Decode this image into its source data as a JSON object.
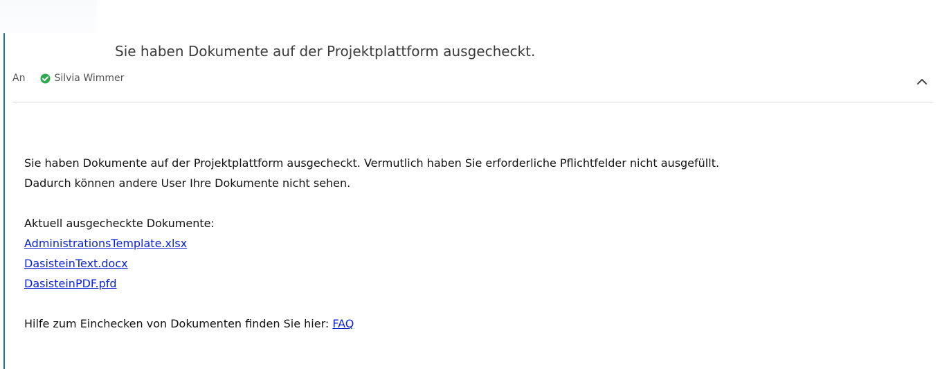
{
  "email": {
    "subject": "Sie haben Dokumente auf der Projektplattform ausgecheckt.",
    "to_label": "An",
    "recipient": "Silvia Wimmer",
    "recipient_status_color": "#2fa84f",
    "collapse_icon": "chevron-up-icon"
  },
  "body": {
    "intro_line1": "Sie haben Dokumente auf der Projektplattform ausgecheckt. Vermutlich haben Sie erforderliche Pflichtfelder nicht ausgefüllt.",
    "intro_line2": "Dadurch können andere User Ihre Dokumente nicht sehen.",
    "list_heading": "Aktuell ausgecheckte Dokumente:",
    "documents": [
      "AdministrationsTemplate.xlsx",
      "DasisteinText.docx",
      "DasisteinPDF.pfd"
    ],
    "help_text": "Hilfe zum Einchecken von Dokumenten finden Sie hier: ",
    "faq_label": "FAQ",
    "link_color": "#0b22d4"
  }
}
